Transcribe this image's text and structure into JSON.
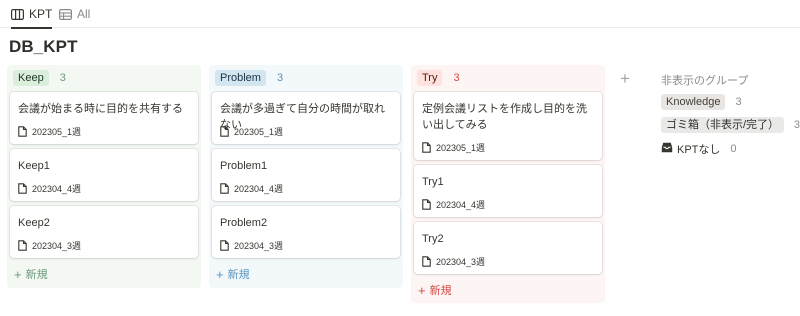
{
  "tabs": [
    {
      "label": "KPT",
      "icon": "board-icon",
      "active": true
    },
    {
      "label": "All",
      "icon": "table-icon",
      "active": false
    }
  ],
  "page": {
    "title": "DB_KPT"
  },
  "columns": [
    {
      "label": "Keep",
      "count": "3",
      "colors": {
        "bg": "#f4f8f3",
        "pill_bg": "#dbeddb",
        "pill_text": "#1c3829",
        "count": "#6c9b7d",
        "new": "#6c9b7d"
      },
      "cards": [
        {
          "title": "会議が始まる時に目的を共有する",
          "week": "202305_1週"
        },
        {
          "title": "Keep1",
          "week": "202304_4週"
        },
        {
          "title": "Keep2",
          "week": "202304_3週"
        }
      ],
      "new_label": "新規"
    },
    {
      "label": "Problem",
      "count": "3",
      "colors": {
        "bg": "#f3f8fb",
        "pill_bg": "#d3e5ef",
        "pill_text": "#183347",
        "count": "#5b97bd",
        "new": "#5b97bd"
      },
      "cards": [
        {
          "title": "会議が多過ぎて自分の時間が取れない",
          "week": "202305_1週"
        },
        {
          "title": "Problem1",
          "week": "202304_4週"
        },
        {
          "title": "Problem2",
          "week": "202304_3週"
        }
      ],
      "new_label": "新規"
    },
    {
      "label": "Try",
      "count": "3",
      "colors": {
        "bg": "#fdf5f3",
        "pill_bg": "#ffe2dd",
        "pill_text": "#5d1715",
        "count": "#d44c47",
        "new": "#d44c47"
      },
      "cards": [
        {
          "title": "定例会議リストを作成し目的を洗い出してみる",
          "week": "202305_1週"
        },
        {
          "title": "Try1",
          "week": "202304_4週"
        },
        {
          "title": "Try2",
          "week": "202304_3週"
        }
      ],
      "new_label": "新規"
    }
  ],
  "hidden_groups": {
    "title": "非表示のグループ",
    "items": [
      {
        "label": "Knowledge",
        "count": "3",
        "pill_bg": "#e9e5e3",
        "pill_text": "#44403c"
      },
      {
        "label": "ゴミ箱（非表示/完了）",
        "count": "3",
        "pill_bg": "#e9e9e7",
        "pill_text": "#32302c"
      },
      {
        "label": "KPTなし",
        "count": "0",
        "icon": "inbox-icon"
      }
    ]
  }
}
